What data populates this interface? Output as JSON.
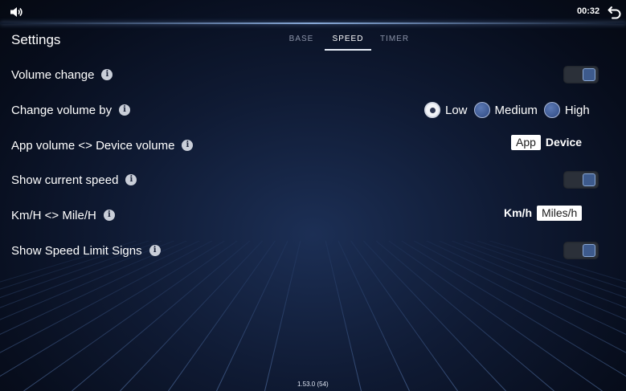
{
  "status": {
    "time": "00:32"
  },
  "header": {
    "title": "Settings",
    "tabs": [
      {
        "label": "BASE",
        "active": false
      },
      {
        "label": "SPEED",
        "active": true
      },
      {
        "label": "TIMER",
        "active": false
      }
    ]
  },
  "settings": {
    "volume_change": {
      "label": "Volume change",
      "toggle_on": true
    },
    "change_volume_by": {
      "label": "Change volume by",
      "options": [
        "Low",
        "Medium",
        "High"
      ],
      "selected": "Low"
    },
    "app_device_volume": {
      "label": "App volume <> Device volume",
      "options": [
        "App",
        "Device"
      ],
      "selected": "App"
    },
    "show_current_speed": {
      "label": "Show current speed",
      "toggle_on": true
    },
    "speed_units": {
      "label": "Km/H <> Mile/H",
      "options": [
        "Km/h",
        "Miles/h"
      ],
      "selected": "Miles/h"
    },
    "show_speed_limit_signs": {
      "label": "Show Speed Limit Signs",
      "toggle_on": true
    }
  },
  "footer": {
    "version": "1.53.0 (54)"
  },
  "icons": {
    "speaker": "speaker-icon",
    "back": "back-arrow-icon",
    "info": "info-icon"
  },
  "colors": {
    "toggle_knob": "#3d5a8c",
    "accent_line": "#e8eef8"
  }
}
